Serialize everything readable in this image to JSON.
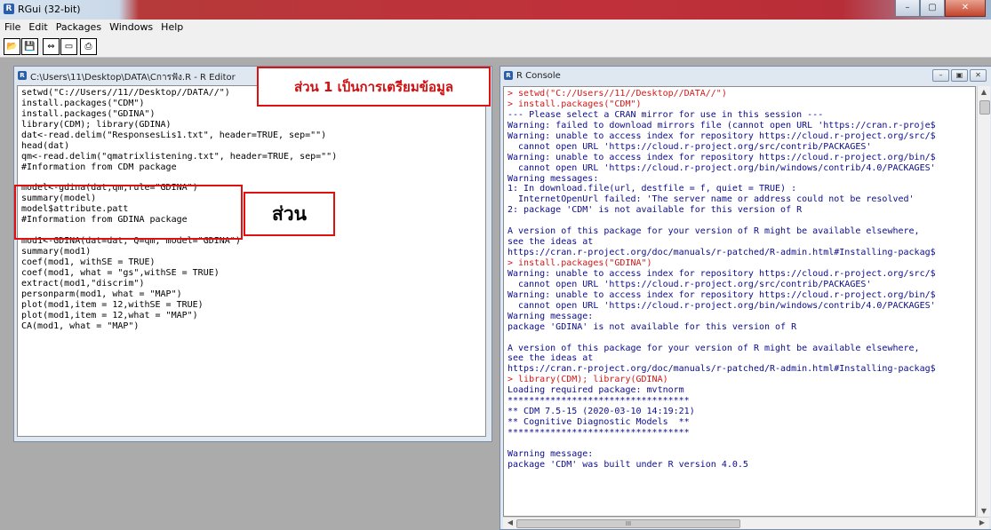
{
  "app": {
    "title": "RGui (32-bit)",
    "icon": "r-logo-icon"
  },
  "menu": [
    "File",
    "Edit",
    "Packages",
    "Windows",
    "Help"
  ],
  "toolbar": [
    {
      "name": "open-script-icon",
      "glyph": "📂"
    },
    {
      "name": "save-icon",
      "glyph": "💾"
    },
    {
      "name": "paste-commands-icon",
      "glyph": "⇔"
    },
    {
      "name": "copy-paste-icon",
      "glyph": "▭"
    },
    {
      "name": "print-icon",
      "glyph": "⎙"
    }
  ],
  "editor": {
    "title": "C:\\Users\\11\\Desktop\\DATA\\Cการฟัง.R - R Editor",
    "lines": [
      "setwd(\"C://Users//11//Desktop//DATA//\")",
      "install.packages(\"CDM\")",
      "install.packages(\"GDINA\")",
      "library(CDM); library(GDINA)",
      "dat<-read.delim(\"ResponsesLis1.txt\", header=TRUE, sep=\"\")",
      "head(dat)",
      "qm<-read.delim(\"qmatrixlistening.txt\", header=TRUE, sep=\"\")",
      "#Information from CDM package",
      "",
      "model<-gdina(dat,qm,rule=\"GDINA\")",
      "summary(model)",
      "model$attribute.patt",
      "#Information from GDINA package",
      "",
      "mod1<-GDINA(dat=dat, Q=qm, model=\"GDINA\")",
      "summary(mod1)",
      "coef(mod1, withSE = TRUE)",
      "coef(mod1, what = \"gs\",withSE = TRUE)",
      "extract(mod1,\"discrim\")",
      "personparm(mod1, what = \"MAP\")",
      "plot(mod1,item = 12,withSE = TRUE)",
      "plot(mod1,item = 12,what = \"MAP\")",
      "CA(mod1, what = \"MAP\")"
    ]
  },
  "annotations": {
    "part1": "ส่วน 1 เป็นการเตรียมข้อมูล",
    "part2": "ส่วน"
  },
  "console": {
    "title": "R Console",
    "lines": [
      {
        "t": "> setwd(\"C://Users//11//Desktop//DATA//\")",
        "c": "red"
      },
      {
        "t": "> install.packages(\"CDM\")",
        "c": "red"
      },
      {
        "t": "--- Please select a CRAN mirror for use in this session ---",
        "c": "blue"
      },
      {
        "t": "Warning: failed to download mirrors file (cannot open URL 'https://cran.r-proje$",
        "c": "blue"
      },
      {
        "t": "Warning: unable to access index for repository https://cloud.r-project.org/src/$",
        "c": "blue"
      },
      {
        "t": "  cannot open URL 'https://cloud.r-project.org/src/contrib/PACKAGES'",
        "c": "blue"
      },
      {
        "t": "Warning: unable to access index for repository https://cloud.r-project.org/bin/$",
        "c": "blue"
      },
      {
        "t": "  cannot open URL 'https://cloud.r-project.org/bin/windows/contrib/4.0/PACKAGES'",
        "c": "blue"
      },
      {
        "t": "Warning messages:",
        "c": "blue"
      },
      {
        "t": "1: In download.file(url, destfile = f, quiet = TRUE) :",
        "c": "blue"
      },
      {
        "t": "  InternetOpenUrl failed: 'The server name or address could not be resolved'",
        "c": "blue"
      },
      {
        "t": "2: package 'CDM' is not available for this version of R",
        "c": "blue"
      },
      {
        "t": "",
        "c": "blue"
      },
      {
        "t": "A version of this package for your version of R might be available elsewhere,",
        "c": "blue"
      },
      {
        "t": "see the ideas at",
        "c": "blue"
      },
      {
        "t": "https://cran.r-project.org/doc/manuals/r-patched/R-admin.html#Installing-packag$",
        "c": "blue"
      },
      {
        "t": "> install.packages(\"GDINA\")",
        "c": "red"
      },
      {
        "t": "Warning: unable to access index for repository https://cloud.r-project.org/src/$",
        "c": "blue"
      },
      {
        "t": "  cannot open URL 'https://cloud.r-project.org/src/contrib/PACKAGES'",
        "c": "blue"
      },
      {
        "t": "Warning: unable to access index for repository https://cloud.r-project.org/bin/$",
        "c": "blue"
      },
      {
        "t": "  cannot open URL 'https://cloud.r-project.org/bin/windows/contrib/4.0/PACKAGES'",
        "c": "blue"
      },
      {
        "t": "Warning message:",
        "c": "blue"
      },
      {
        "t": "package 'GDINA' is not available for this version of R",
        "c": "blue"
      },
      {
        "t": "",
        "c": "blue"
      },
      {
        "t": "A version of this package for your version of R might be available elsewhere,",
        "c": "blue"
      },
      {
        "t": "see the ideas at",
        "c": "blue"
      },
      {
        "t": "https://cran.r-project.org/doc/manuals/r-patched/R-admin.html#Installing-packag$",
        "c": "blue"
      },
      {
        "t": "> library(CDM); library(GDINA)",
        "c": "red"
      },
      {
        "t": "Loading required package: mvtnorm",
        "c": "blue"
      },
      {
        "t": "**********************************",
        "c": "blue"
      },
      {
        "t": "** CDM 7.5-15 (2020-03-10 14:19:21)",
        "c": "blue"
      },
      {
        "t": "** Cognitive Diagnostic Models  **",
        "c": "blue"
      },
      {
        "t": "**********************************",
        "c": "blue"
      },
      {
        "t": "",
        "c": "blue"
      },
      {
        "t": "Warning message:",
        "c": "blue"
      },
      {
        "t": "package 'CDM' was built under R version 4.0.5",
        "c": "blue"
      }
    ],
    "hscroll_marker": "III"
  },
  "colors": {
    "prompt": "#d41717",
    "output": "#0c0c8c",
    "annotation": "#e01010"
  }
}
